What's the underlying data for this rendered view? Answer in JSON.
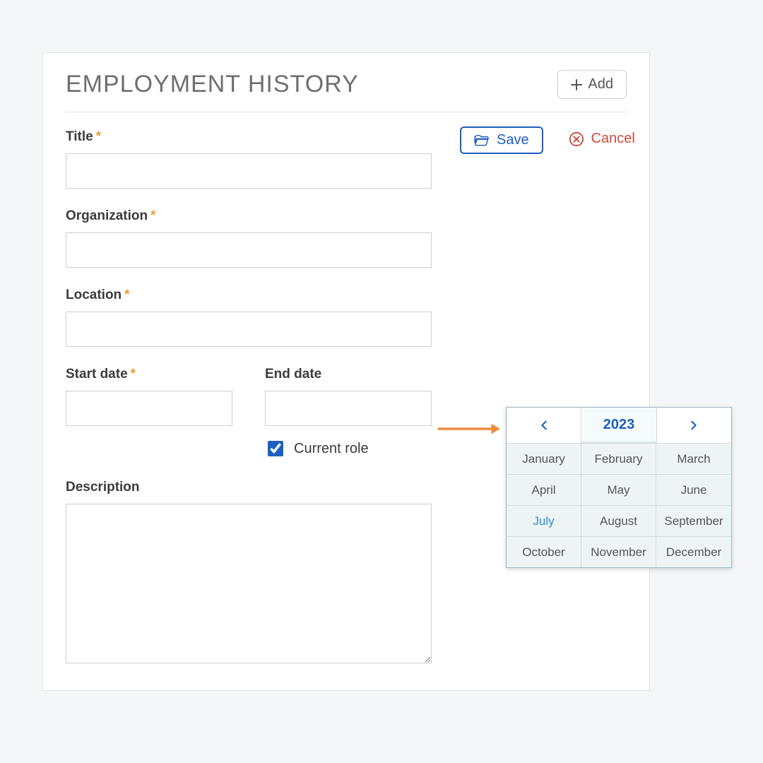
{
  "section": {
    "title": "EMPLOYMENT HISTORY",
    "add_label": "Add"
  },
  "actions": {
    "save_label": "Save",
    "cancel_label": "Cancel"
  },
  "fields": {
    "title": {
      "label": "Title",
      "required_mark": "*",
      "value": ""
    },
    "organization": {
      "label": "Organization",
      "required_mark": "*",
      "value": ""
    },
    "location": {
      "label": "Location",
      "required_mark": "*",
      "value": ""
    },
    "start_date": {
      "label": "Start date",
      "required_mark": "*",
      "value": ""
    },
    "end_date": {
      "label": "End date",
      "value": ""
    },
    "current_role": {
      "label": "Current role",
      "checked": true
    },
    "description": {
      "label": "Description",
      "value": ""
    }
  },
  "month_picker": {
    "year": "2023",
    "current_month": "July",
    "months": [
      "January",
      "February",
      "March",
      "April",
      "May",
      "June",
      "July",
      "August",
      "September",
      "October",
      "November",
      "December"
    ]
  }
}
